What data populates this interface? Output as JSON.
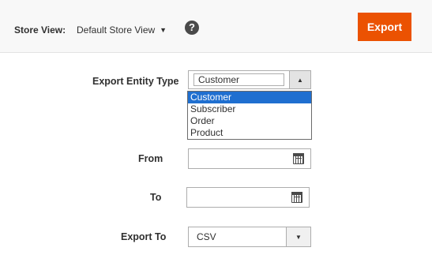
{
  "header": {
    "store_label": "Store View:",
    "store_value": "Default Store View",
    "caret": "▼",
    "help": "?",
    "export_label": "Export"
  },
  "form": {
    "entity_type": {
      "label": "Export Entity Type",
      "value": "Customer",
      "arrow": "▲",
      "options": [
        "Customer",
        "Subscriber",
        "Order",
        "Product"
      ],
      "selected_index": 0
    },
    "from": {
      "label": "From",
      "value": ""
    },
    "to": {
      "label": "To",
      "value": ""
    },
    "export_to": {
      "label": "Export To",
      "value": "CSV",
      "arrow": "▼"
    }
  },
  "colors": {
    "accent": "#eb5202",
    "selection": "#1f6fd0"
  }
}
